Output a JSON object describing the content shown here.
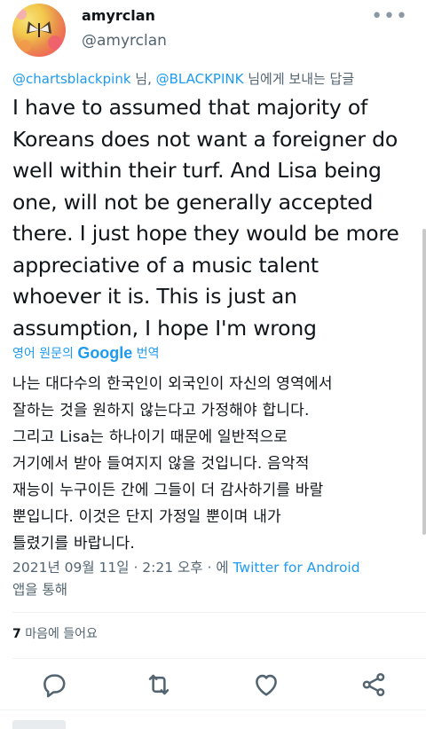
{
  "author": {
    "display_name": "amyrclan",
    "handle": "@amyrclan"
  },
  "reply_to": {
    "mention1": "@chartsblackpink",
    "sep": " 님, ",
    "mention2": "@BLACKPINK",
    "suffix": " 님에게 보내는 답글"
  },
  "tweet": {
    "lines": [
      "I have to assumed that majority of",
      "Koreans does not want a foreigner do",
      "well within their turf. And Lisa being",
      "one, will not be generally accepted",
      "there. I just hope they would be more",
      "appreciative of a music talent",
      "whoever it is. This is just an",
      "assumption, I hope I'm wrong"
    ]
  },
  "translation": {
    "prefix": "영어 원문의 ",
    "brand": "Google",
    "suffix": " 번역",
    "lines": [
      "나는 대다수의 한국인이 외국인이 자신의 영역에서",
      "잘하는 것을 원하지 않는다고 가정해야 합니다.",
      "그리고 Lisa는 하나이기 때문에 일반적으로",
      "거기에서 받아 들여지지 않을 것입니다. 음악적",
      "재능이 누구이든 간에 그들이 더 감사하기를 바랄",
      "뿐입니다. 이것은 단지 가정일 뿐이며 내가",
      "틀렸기를 바랍니다."
    ]
  },
  "meta": {
    "timestamp": "2021년 09월 11일 · 2:21 오후 · 에 ",
    "source": "Twitter for Android",
    "via": "앱을 통해"
  },
  "likes": {
    "count": "7",
    "label": " 마음에 들어요"
  },
  "icons": {
    "more": "more-icon",
    "reply": "reply-icon",
    "retweet": "retweet-icon",
    "like": "heart-icon",
    "share": "share-icon"
  },
  "colors": {
    "link": "#1d9bf0",
    "secondary": "#536471",
    "text": "#0f1419"
  }
}
